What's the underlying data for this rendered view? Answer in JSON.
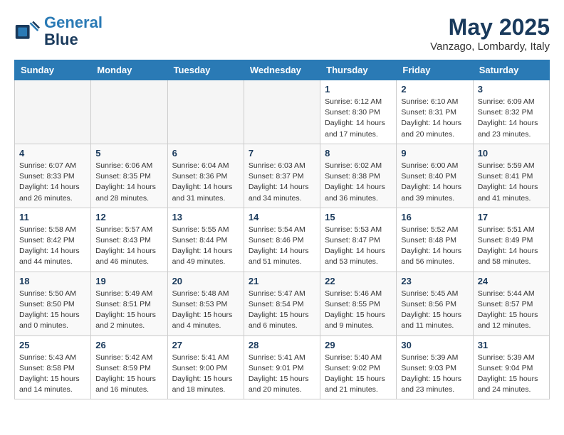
{
  "header": {
    "logo_line1": "General",
    "logo_line2": "Blue",
    "month": "May 2025",
    "location": "Vanzago, Lombardy, Italy"
  },
  "weekdays": [
    "Sunday",
    "Monday",
    "Tuesday",
    "Wednesday",
    "Thursday",
    "Friday",
    "Saturday"
  ],
  "weeks": [
    [
      {
        "day": "",
        "empty": true
      },
      {
        "day": "",
        "empty": true
      },
      {
        "day": "",
        "empty": true
      },
      {
        "day": "",
        "empty": true
      },
      {
        "day": "1",
        "sunrise": "6:12 AM",
        "sunset": "8:30 PM",
        "daylight": "14 hours and 17 minutes."
      },
      {
        "day": "2",
        "sunrise": "6:10 AM",
        "sunset": "8:31 PM",
        "daylight": "14 hours and 20 minutes."
      },
      {
        "day": "3",
        "sunrise": "6:09 AM",
        "sunset": "8:32 PM",
        "daylight": "14 hours and 23 minutes."
      }
    ],
    [
      {
        "day": "4",
        "sunrise": "6:07 AM",
        "sunset": "8:33 PM",
        "daylight": "14 hours and 26 minutes."
      },
      {
        "day": "5",
        "sunrise": "6:06 AM",
        "sunset": "8:35 PM",
        "daylight": "14 hours and 28 minutes."
      },
      {
        "day": "6",
        "sunrise": "6:04 AM",
        "sunset": "8:36 PM",
        "daylight": "14 hours and 31 minutes."
      },
      {
        "day": "7",
        "sunrise": "6:03 AM",
        "sunset": "8:37 PM",
        "daylight": "14 hours and 34 minutes."
      },
      {
        "day": "8",
        "sunrise": "6:02 AM",
        "sunset": "8:38 PM",
        "daylight": "14 hours and 36 minutes."
      },
      {
        "day": "9",
        "sunrise": "6:00 AM",
        "sunset": "8:40 PM",
        "daylight": "14 hours and 39 minutes."
      },
      {
        "day": "10",
        "sunrise": "5:59 AM",
        "sunset": "8:41 PM",
        "daylight": "14 hours and 41 minutes."
      }
    ],
    [
      {
        "day": "11",
        "sunrise": "5:58 AM",
        "sunset": "8:42 PM",
        "daylight": "14 hours and 44 minutes."
      },
      {
        "day": "12",
        "sunrise": "5:57 AM",
        "sunset": "8:43 PM",
        "daylight": "14 hours and 46 minutes."
      },
      {
        "day": "13",
        "sunrise": "5:55 AM",
        "sunset": "8:44 PM",
        "daylight": "14 hours and 49 minutes."
      },
      {
        "day": "14",
        "sunrise": "5:54 AM",
        "sunset": "8:46 PM",
        "daylight": "14 hours and 51 minutes."
      },
      {
        "day": "15",
        "sunrise": "5:53 AM",
        "sunset": "8:47 PM",
        "daylight": "14 hours and 53 minutes."
      },
      {
        "day": "16",
        "sunrise": "5:52 AM",
        "sunset": "8:48 PM",
        "daylight": "14 hours and 56 minutes."
      },
      {
        "day": "17",
        "sunrise": "5:51 AM",
        "sunset": "8:49 PM",
        "daylight": "14 hours and 58 minutes."
      }
    ],
    [
      {
        "day": "18",
        "sunrise": "5:50 AM",
        "sunset": "8:50 PM",
        "daylight": "15 hours and 0 minutes."
      },
      {
        "day": "19",
        "sunrise": "5:49 AM",
        "sunset": "8:51 PM",
        "daylight": "15 hours and 2 minutes."
      },
      {
        "day": "20",
        "sunrise": "5:48 AM",
        "sunset": "8:53 PM",
        "daylight": "15 hours and 4 minutes."
      },
      {
        "day": "21",
        "sunrise": "5:47 AM",
        "sunset": "8:54 PM",
        "daylight": "15 hours and 6 minutes."
      },
      {
        "day": "22",
        "sunrise": "5:46 AM",
        "sunset": "8:55 PM",
        "daylight": "15 hours and 9 minutes."
      },
      {
        "day": "23",
        "sunrise": "5:45 AM",
        "sunset": "8:56 PM",
        "daylight": "15 hours and 11 minutes."
      },
      {
        "day": "24",
        "sunrise": "5:44 AM",
        "sunset": "8:57 PM",
        "daylight": "15 hours and 12 minutes."
      }
    ],
    [
      {
        "day": "25",
        "sunrise": "5:43 AM",
        "sunset": "8:58 PM",
        "daylight": "15 hours and 14 minutes."
      },
      {
        "day": "26",
        "sunrise": "5:42 AM",
        "sunset": "8:59 PM",
        "daylight": "15 hours and 16 minutes."
      },
      {
        "day": "27",
        "sunrise": "5:41 AM",
        "sunset": "9:00 PM",
        "daylight": "15 hours and 18 minutes."
      },
      {
        "day": "28",
        "sunrise": "5:41 AM",
        "sunset": "9:01 PM",
        "daylight": "15 hours and 20 minutes."
      },
      {
        "day": "29",
        "sunrise": "5:40 AM",
        "sunset": "9:02 PM",
        "daylight": "15 hours and 21 minutes."
      },
      {
        "day": "30",
        "sunrise": "5:39 AM",
        "sunset": "9:03 PM",
        "daylight": "15 hours and 23 minutes."
      },
      {
        "day": "31",
        "sunrise": "5:39 AM",
        "sunset": "9:04 PM",
        "daylight": "15 hours and 24 minutes."
      }
    ]
  ]
}
